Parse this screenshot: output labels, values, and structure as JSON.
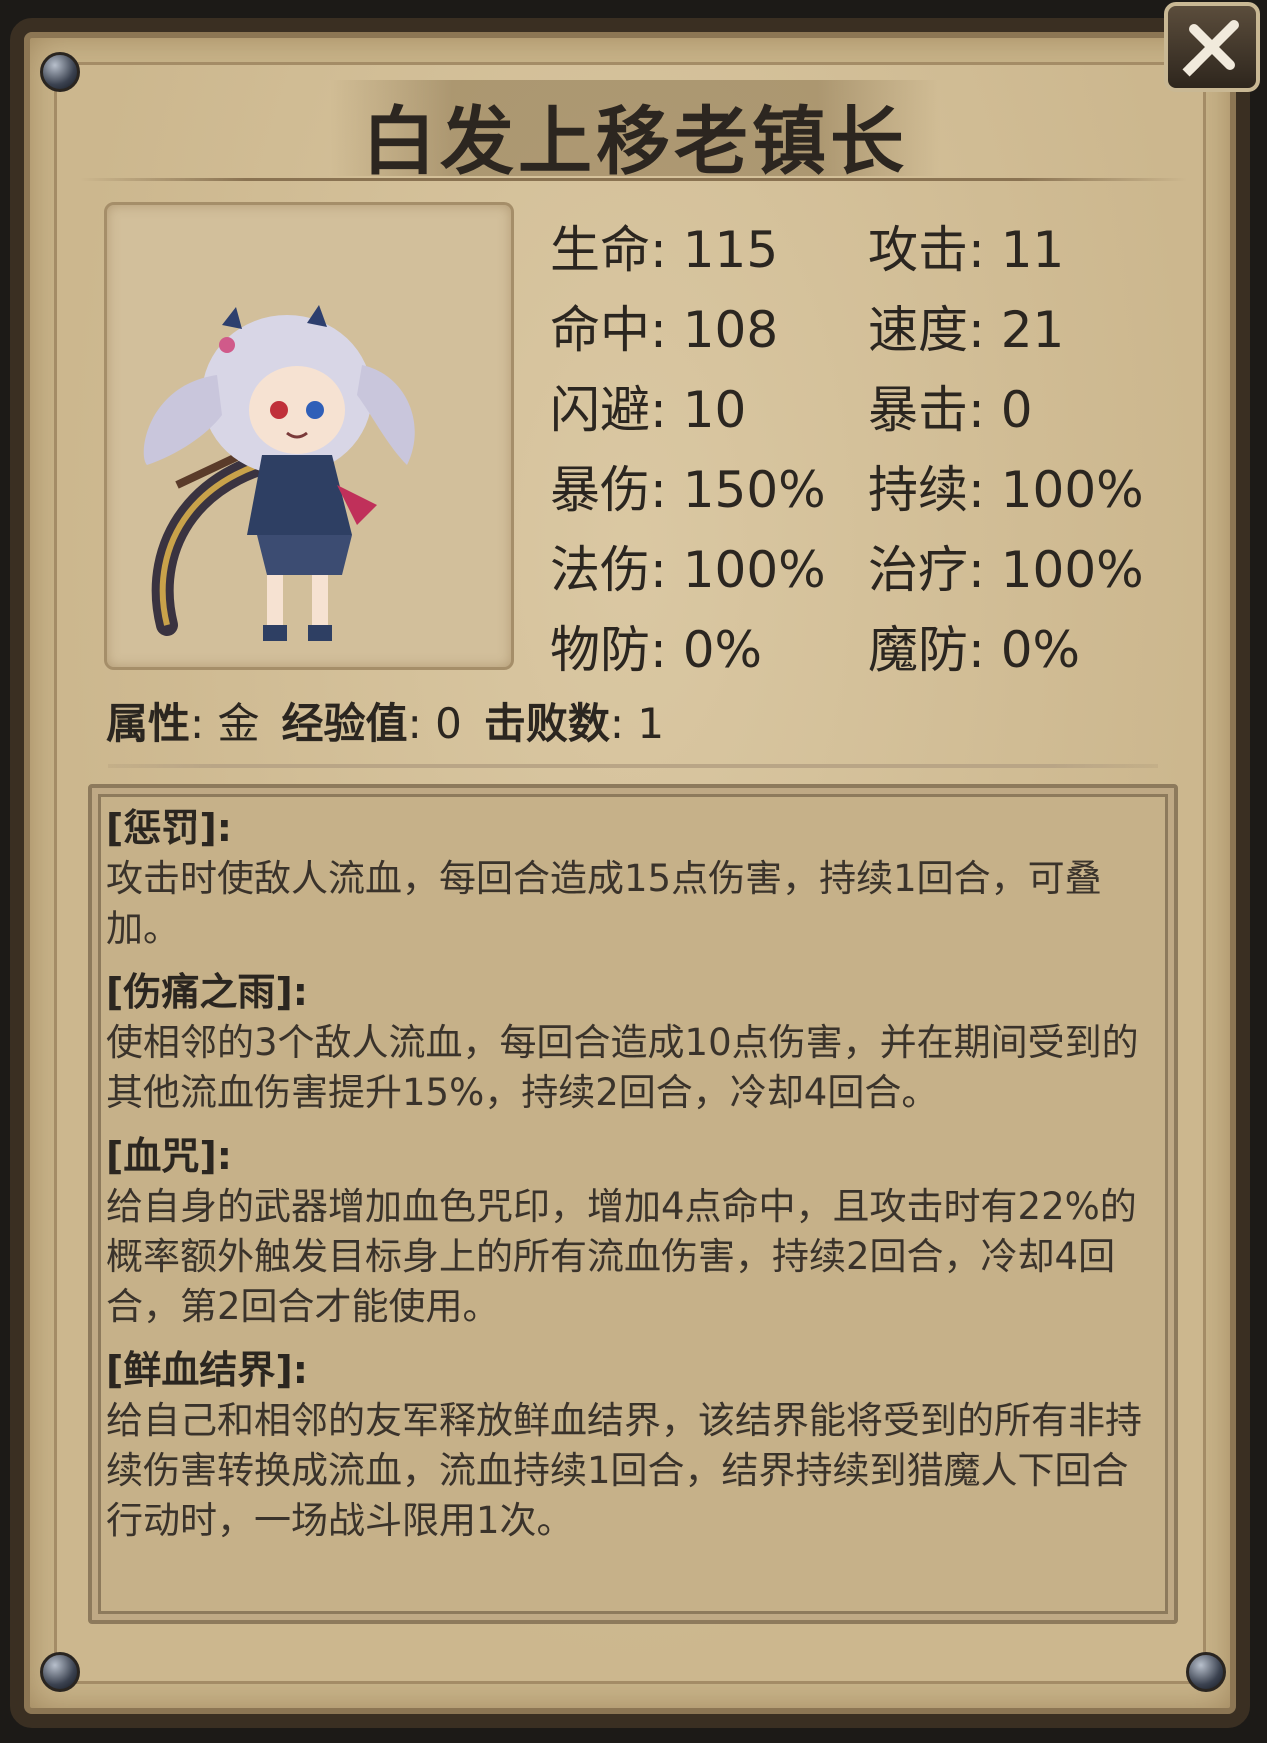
{
  "window": {
    "title": "白发上移老镇长",
    "close_icon": "close-swords-icon"
  },
  "stats": [
    {
      "label": "生命",
      "value": "115"
    },
    {
      "label": "攻击",
      "value": "11"
    },
    {
      "label": "命中",
      "value": "108"
    },
    {
      "label": "速度",
      "value": "21"
    },
    {
      "label": "闪避",
      "value": "10"
    },
    {
      "label": "暴击",
      "value": "0"
    },
    {
      "label": "暴伤",
      "value": "150%"
    },
    {
      "label": "持续",
      "value": "100%"
    },
    {
      "label": "法伤",
      "value": "100%"
    },
    {
      "label": "治疗",
      "value": "100%"
    },
    {
      "label": "物防",
      "value": "0%"
    },
    {
      "label": "魔防",
      "value": "0%"
    }
  ],
  "meta": {
    "attribute_label": "属性",
    "attribute_value": "金",
    "exp_label": "经验值",
    "exp_value": "0",
    "defeats_label": "击败数",
    "defeats_value": "1"
  },
  "skills": [
    {
      "name": "[惩罚]:",
      "desc": "攻击时使敌人流血，每回合造成15点伤害，持续1回合，可叠加。"
    },
    {
      "name": "[伤痛之雨]:",
      "desc": "使相邻的3个敌人流血，每回合造成10点伤害，并在期间受到的其他流血伤害提升15%，持续2回合，冷却4回合。"
    },
    {
      "name": "[血咒]:",
      "desc": "给自身的武器增加血色咒印，增加4点命中，且攻击时有22%的概率额外触发目标身上的所有流血伤害，持续2回合，冷却4回合，第2回合才能使用。"
    },
    {
      "name": "[鲜血结界]:",
      "desc": "给自己和相邻的友军释放鲜血结界，该结界能将受到的所有非持续伤害转换成流血，流血持续1回合，结界持续到猎魔人下回合行动时，一场战斗限用1次。"
    }
  ],
  "colors": {
    "parchment": "#ccb78e",
    "frame": "#3a2f22",
    "text": "#2b2620"
  }
}
